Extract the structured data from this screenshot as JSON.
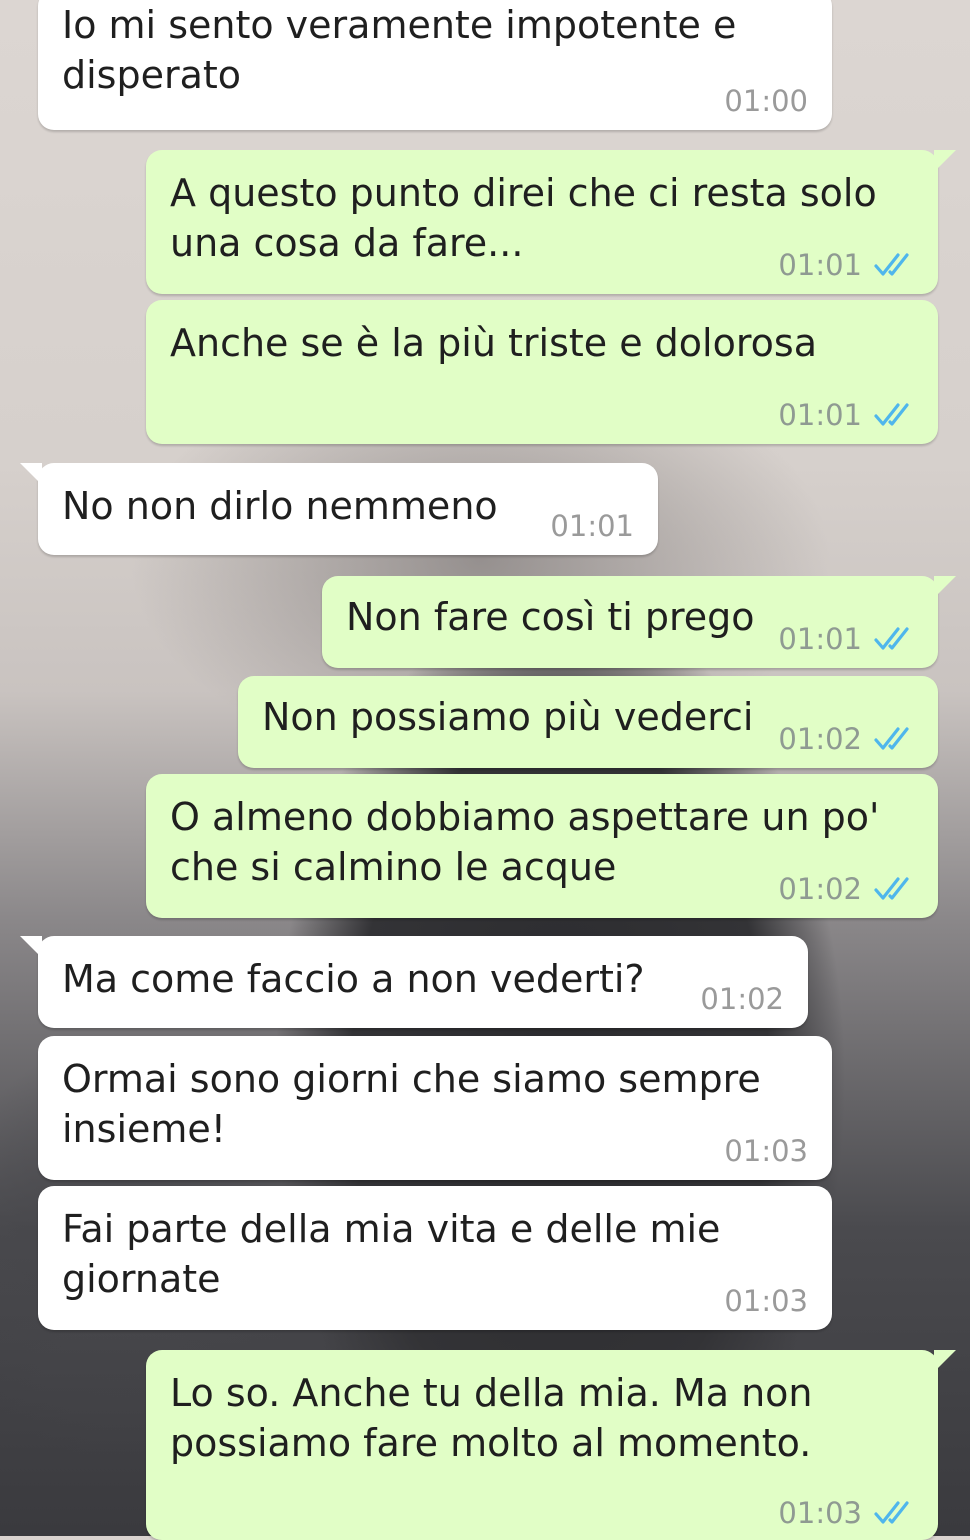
{
  "messages": [
    {
      "text": "Io mi sento veramente impotente e\ndisperato",
      "time": "01:00"
    },
    {
      "text": "A questo punto direi che ci resta solo\nuna cosa da fare...",
      "time": "01:01"
    },
    {
      "text": "Anche se è la più triste e dolorosa",
      "time": "01:01"
    },
    {
      "text": "No non dirlo nemmeno",
      "time": "01:01"
    },
    {
      "text": "Non fare così ti prego",
      "time": "01:01"
    },
    {
      "text": "Non possiamo più vederci",
      "time": "01:02"
    },
    {
      "text": "O almeno dobbiamo aspettare un po'\nche si calmino le acque",
      "time": "01:02"
    },
    {
      "text": "Ma come faccio a non vederti?",
      "time": "01:02"
    },
    {
      "text": "Ormai sono giorni che siamo sempre\ninsieme!",
      "time": "01:03"
    },
    {
      "text": "Fai parte della mia vita e delle mie\ngiornate",
      "time": "01:03"
    },
    {
      "text": "Lo so. Anche tu della mia. Ma non\npossiamo fare molto al momento.",
      "time": "01:03"
    }
  ],
  "theme": {
    "incoming_bubble": "#ffffff",
    "outgoing_bubble": "#e1fec6",
    "read_ticks": "#4fb6ec",
    "read_ticks_icon": "double-check-icon"
  }
}
